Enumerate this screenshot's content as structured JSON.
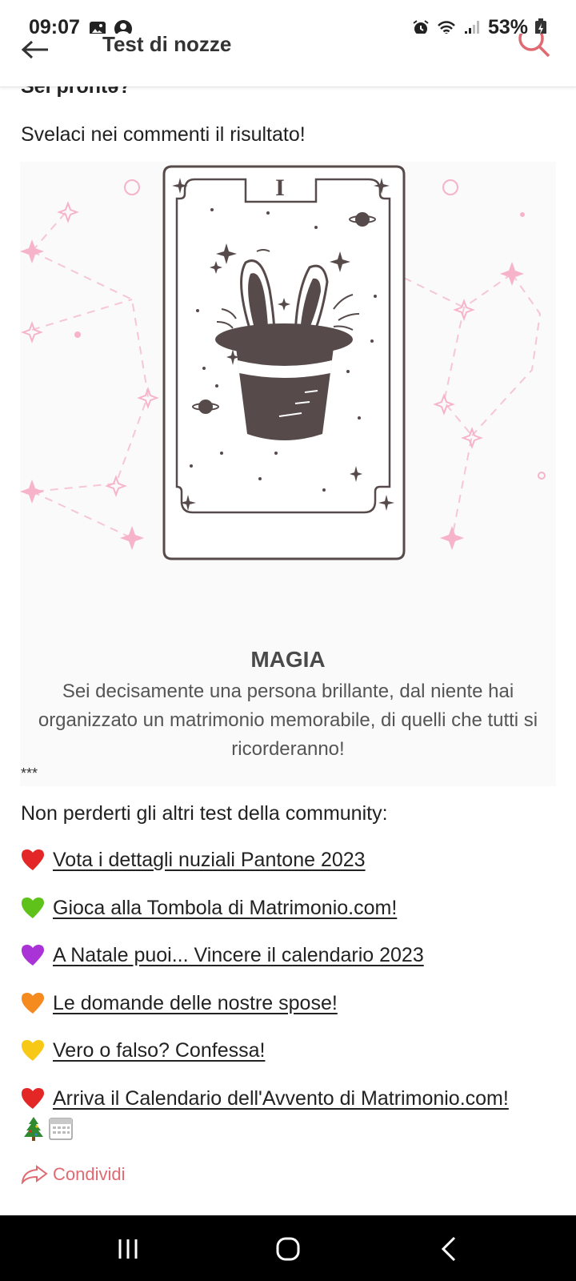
{
  "status": {
    "time": "09:07",
    "battery": "53%"
  },
  "header": {
    "title": "Test di nozze"
  },
  "content": {
    "partial_heading": "Sei prontə?",
    "intro": "Svelaci nei commenti il risultato!",
    "card": {
      "numeral": "I",
      "title": "MAGIA",
      "description": "Sei decisamente una persona brillante, dal niente hai organizzato un matrimonio memorabile, di quelli che tutti si ricorderanno!"
    },
    "separator": "***",
    "more_title": "Non perderti gli altri test della community:",
    "links": [
      {
        "color": "#e32626",
        "label": "Vota i dettagli nuziali Pantone 2023",
        "icon": "red-heart-icon"
      },
      {
        "color": "#5fc21b",
        "label": "Gioca alla Tombola di Matrimonio.com!",
        "icon": "green-heart-icon"
      },
      {
        "color": "#a933d6",
        "label": "A Natale puoi... Vincere il calendario 2023",
        "icon": "purple-heart-icon"
      },
      {
        "color": "#f58a1f",
        "label": "Le domande delle nostre spose!",
        "icon": "orange-heart-icon"
      },
      {
        "color": "#f7c916",
        "label": "Vero o falso? Confessa!",
        "icon": "yellow-heart-icon"
      },
      {
        "color": "#e32626",
        "label": "Arriva il Calendario dell'Avvento di Matrimonio.com!",
        "icon": "red-heart-icon"
      }
    ],
    "share_label": "Condividi"
  },
  "colors": {
    "accent": "#e06a72",
    "card_ink": "#574a4a",
    "constellation": "#f6c6d6"
  }
}
